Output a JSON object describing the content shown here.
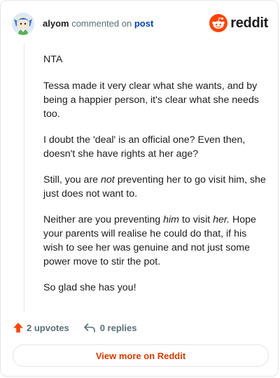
{
  "header": {
    "username": "alyom",
    "verb": "commented on",
    "post_link": "post",
    "brand": "reddit"
  },
  "comment": {
    "paragraphs": [
      "NTA",
      "Tessa made it very clear what she wants, and by being a happier person, it's clear what she needs too.",
      "I doubt the 'deal' is an official one? Even then, doesn't she have rights at her age?",
      "Still, you are not preventing her to go visit him, she just does not want to.",
      "Neither are you preventing him to visit her. Hope your parents will realise he could do that, if his wish to see her was genuine and not just some power move to stir the pot.",
      "So glad she has you!"
    ],
    "p4": {
      "a": "Still, you are ",
      "em": "not",
      "b": " preventing her to go visit him, she just does not want to."
    },
    "p5": {
      "a": "Neither are you preventing ",
      "em1": "him",
      "b": " to visit ",
      "em2": "her.",
      "c": " Hope your parents will realise he could do that, if his wish to see her was genuine and not just some power move to stir the pot."
    }
  },
  "footer": {
    "upvotes": "2 upvotes",
    "replies": "0 replies",
    "view_more": "View more on Reddit"
  },
  "icons": {
    "upvote": "upvote-arrow-icon",
    "reply": "reply-icon",
    "brand": "reddit-snoo-icon"
  },
  "colors": {
    "upvote": "#ff4500",
    "link": "#0045ac",
    "button_text": "#d93a00",
    "brand": "#ff4500"
  }
}
